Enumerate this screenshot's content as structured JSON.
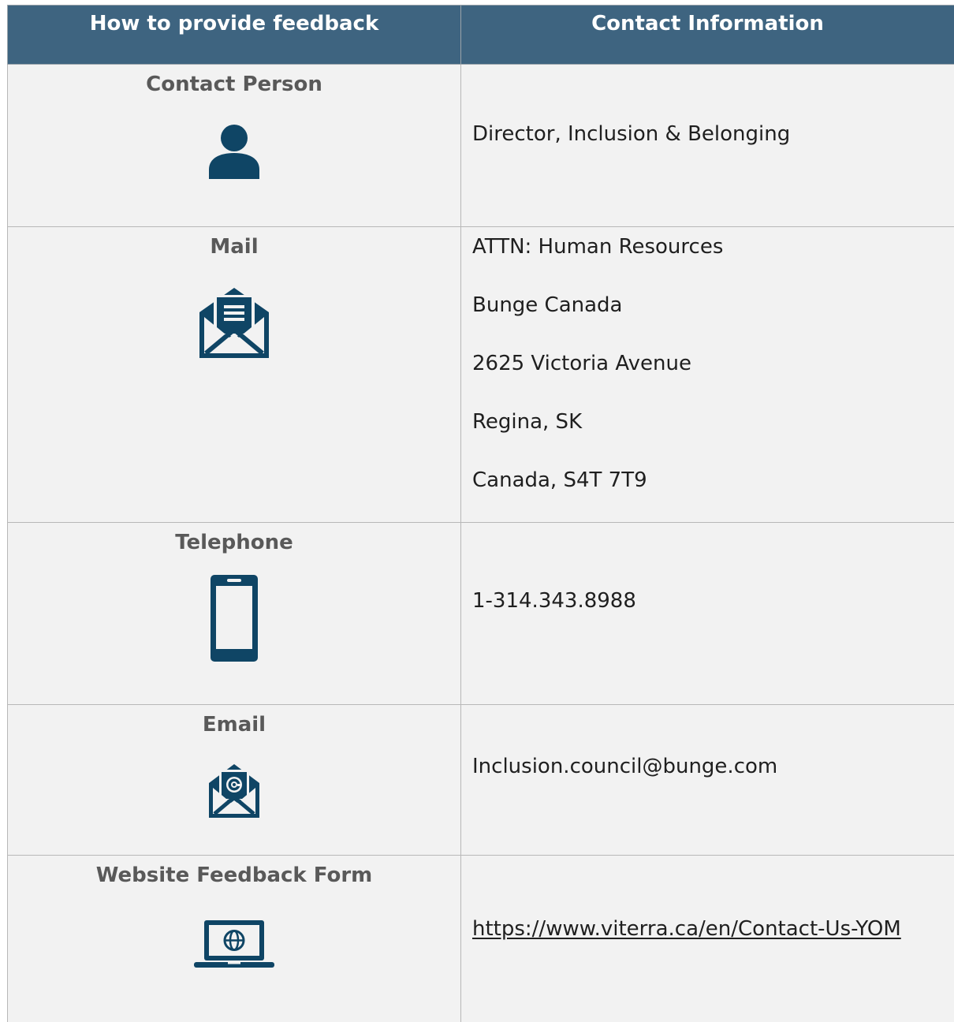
{
  "header": {
    "col1": "How to provide feedback",
    "col2": "Contact Information"
  },
  "rows": [
    {
      "label": "Contact Person",
      "icon": "person-icon",
      "info": [
        "Director, Inclusion & Belonging"
      ]
    },
    {
      "label": "Mail",
      "icon": "mail-letter-icon",
      "info": [
        "ATTN: Human Resources",
        "Bunge Canada",
        "2625 Victoria Avenue",
        "Regina, SK",
        "Canada, S4T 7T9"
      ]
    },
    {
      "label": "Telephone",
      "icon": "phone-icon",
      "info": [
        "1-314.343.8988"
      ]
    },
    {
      "label": "Email",
      "icon": "email-at-icon",
      "info": [
        "Inclusion.council@bunge.com"
      ]
    },
    {
      "label": "Website Feedback Form",
      "icon": "laptop-globe-icon",
      "info": [
        "https://www.viterra.ca/en/Contact-Us-YOM"
      ]
    }
  ],
  "colors": {
    "header_bg": "#3e6480",
    "icon": "#0f4565",
    "cell_bg": "#f2f2f2",
    "label_text": "#595959"
  }
}
